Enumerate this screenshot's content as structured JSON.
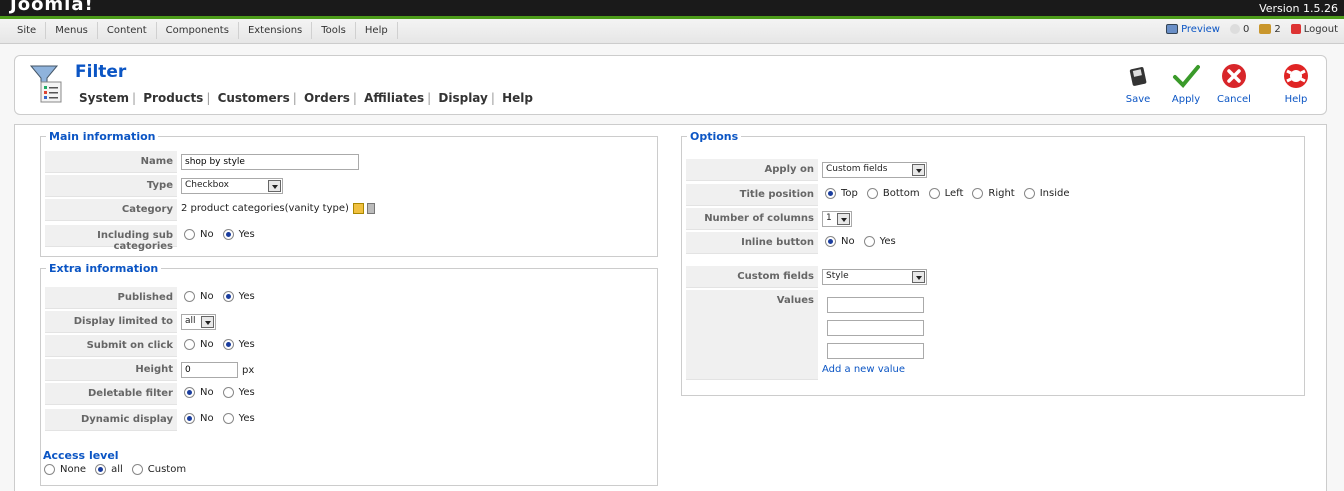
{
  "topbar": {
    "logo": "Joomla!",
    "version": "Version 1.5.26"
  },
  "menubar": {
    "items": [
      "Site",
      "Menus",
      "Content",
      "Components",
      "Extensions",
      "Tools",
      "Help"
    ],
    "preview": "Preview",
    "messages_count": "0",
    "users_count": "2",
    "logout": "Logout"
  },
  "header": {
    "title": "Filter",
    "subnav": [
      "System",
      "Products",
      "Customers",
      "Orders",
      "Affiliates",
      "Display",
      "Help"
    ],
    "buttons": {
      "save": "Save",
      "apply": "Apply",
      "cancel": "Cancel",
      "help": "Help"
    }
  },
  "main_info": {
    "legend": "Main information",
    "name_label": "Name",
    "name_value": "shop by style",
    "type_label": "Type",
    "type_value": "Checkbox",
    "category_label": "Category",
    "category_value": "2 product categories(vanity type)",
    "subcat_label": "Including sub categories",
    "no": "No",
    "yes": "Yes"
  },
  "extra_info": {
    "legend": "Extra information",
    "published_label": "Published",
    "display_limited_label": "Display limited to",
    "display_limited_value": "all",
    "submit_label": "Submit on click",
    "height_label": "Height",
    "height_value": "0",
    "height_unit": "px",
    "deletable_label": "Deletable filter",
    "dynamic_label": "Dynamic display",
    "no": "No",
    "yes": "Yes"
  },
  "access": {
    "title": "Access level",
    "none": "None",
    "all": "all",
    "custom": "Custom"
  },
  "options": {
    "legend": "Options",
    "apply_on_label": "Apply on",
    "apply_on_value": "Custom fields",
    "title_pos_label": "Title position",
    "top": "Top",
    "bottom": "Bottom",
    "left": "Left",
    "right": "Right",
    "inside": "Inside",
    "columns_label": "Number of columns",
    "columns_value": "1",
    "inline_label": "Inline button",
    "no": "No",
    "yes": "Yes",
    "custom_fields_label": "Custom fields",
    "custom_fields_value": "Style",
    "values_label": "Values",
    "add_value": "Add a new value"
  }
}
